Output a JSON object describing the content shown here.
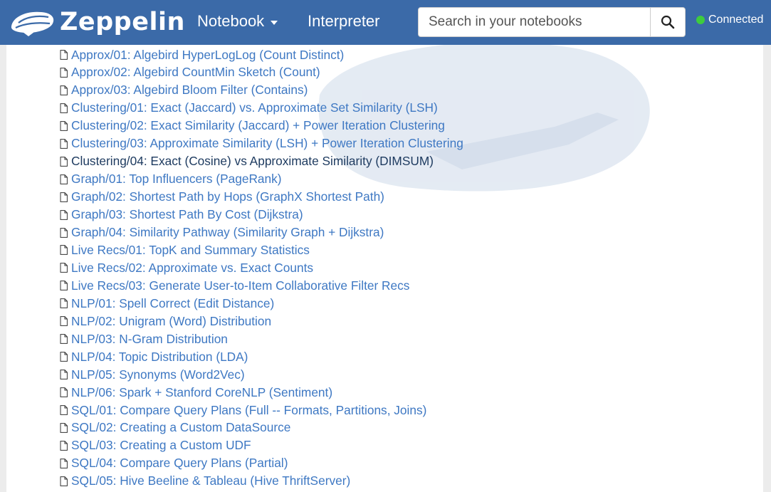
{
  "navbar": {
    "brand": "Zeppelin",
    "menu": [
      {
        "label": "Notebook",
        "dropdown": true
      },
      {
        "label": "Interpreter",
        "dropdown": false
      }
    ],
    "search": {
      "placeholder": "Search in your notebooks",
      "value": "",
      "button_icon": "search-icon"
    },
    "status": {
      "label": "Connected",
      "color": "#3ecc3e"
    }
  },
  "colors": {
    "navbar": "#3b6aa8",
    "link": "#3e78c3",
    "link_hovered": "#1d3a5f"
  },
  "notebooks": [
    {
      "label": "Approx/01: Algebird HyperLogLog (Count Distinct)",
      "icon": "file-icon",
      "hovered": false
    },
    {
      "label": "Approx/02: Algebird CountMin Sketch (Count)",
      "icon": "file-icon",
      "hovered": false
    },
    {
      "label": "Approx/03: Algebird Bloom Filter (Contains)",
      "icon": "file-icon",
      "hovered": false
    },
    {
      "label": "Clustering/01: Exact (Jaccard) vs. Approximate Set Similarity (LSH)",
      "icon": "file-icon",
      "hovered": false
    },
    {
      "label": "Clustering/02: Exact Similarity (Jaccard) + Power Iteration Clustering",
      "icon": "file-icon",
      "hovered": false
    },
    {
      "label": "Clustering/03: Approximate Similarity (LSH) + Power Iteration Clustering",
      "icon": "file-icon",
      "hovered": false
    },
    {
      "label": "Clustering/04: Exact (Cosine) vs Approximate Similarity (DIMSUM)",
      "icon": "file-icon",
      "hovered": true
    },
    {
      "label": "Graph/01: Top Influencers (PageRank)",
      "icon": "file-icon",
      "hovered": false
    },
    {
      "label": "Graph/02: Shortest Path by Hops (GraphX Shortest Path)",
      "icon": "file-icon",
      "hovered": false
    },
    {
      "label": "Graph/03: Shortest Path By Cost (Dijkstra)",
      "icon": "file-icon",
      "hovered": false
    },
    {
      "label": "Graph/04: Similarity Pathway (Similarity Graph + Dijkstra)",
      "icon": "file-icon",
      "hovered": false
    },
    {
      "label": "Live Recs/01: TopK and Summary Statistics",
      "icon": "file-icon",
      "hovered": false
    },
    {
      "label": "Live Recs/02: Approximate vs. Exact Counts",
      "icon": "file-icon",
      "hovered": false
    },
    {
      "label": "Live Recs/03: Generate User-to-Item Collaborative Filter Recs",
      "icon": "file-icon",
      "hovered": false
    },
    {
      "label": "NLP/01: Spell Correct (Edit Distance)",
      "icon": "file-icon",
      "hovered": false
    },
    {
      "label": "NLP/02: Unigram (Word) Distribution",
      "icon": "file-icon",
      "hovered": false
    },
    {
      "label": "NLP/03: N-Gram Distribution",
      "icon": "file-icon",
      "hovered": false
    },
    {
      "label": "NLP/04: Topic Distribution (LDA)",
      "icon": "file-icon",
      "hovered": false
    },
    {
      "label": "NLP/05: Synonyms (Word2Vec)",
      "icon": "file-icon",
      "hovered": false
    },
    {
      "label": "NLP/06: Spark + Stanford CoreNLP (Sentiment)",
      "icon": "file-icon",
      "hovered": false
    },
    {
      "label": "SQL/01: Compare Query Plans (Full -- Formats, Partitions, Joins)",
      "icon": "file-icon",
      "hovered": false
    },
    {
      "label": "SQL/02: Creating a Custom DataSource",
      "icon": "file-icon",
      "hovered": false
    },
    {
      "label": "SQL/03: Creating a Custom UDF",
      "icon": "file-icon",
      "hovered": false
    },
    {
      "label": "SQL/04: Compare Query Plans (Partial)",
      "icon": "file-icon",
      "hovered": false
    },
    {
      "label": "SQL/05: Hive Beeline & Tableau (Hive ThriftServer)",
      "icon": "file-icon",
      "hovered": false
    }
  ]
}
